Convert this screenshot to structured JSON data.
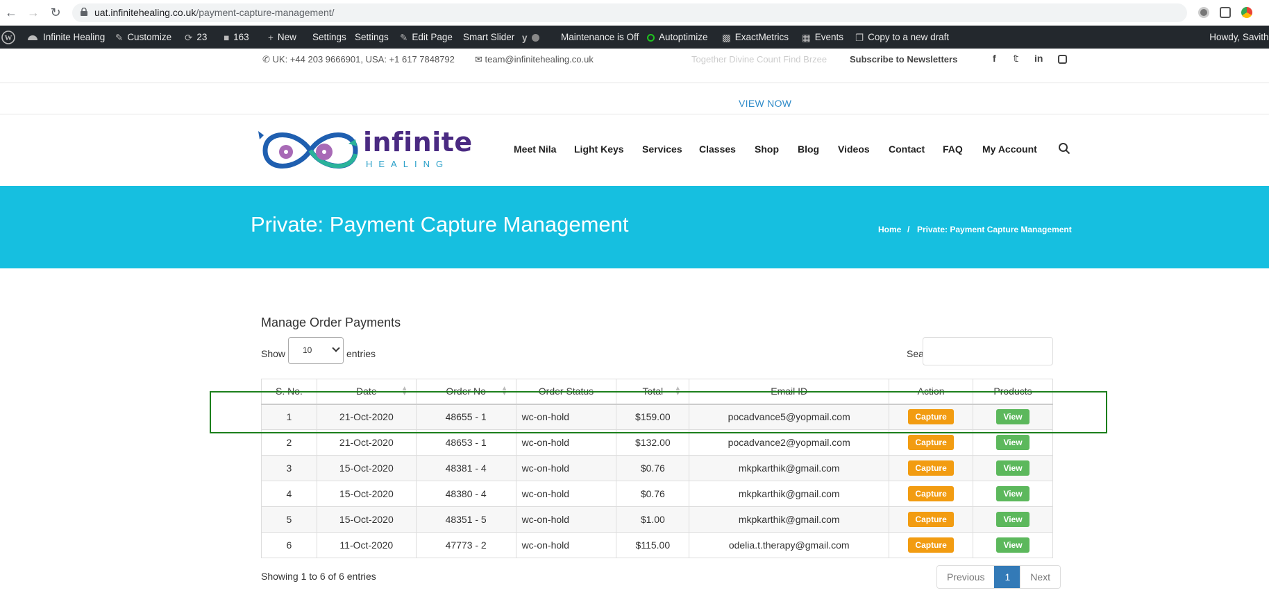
{
  "browser": {
    "url_host": "uat.infinitehealing.co.uk",
    "url_path": "/payment-capture-management/"
  },
  "admin_bar": {
    "site_name": "Infinite Healing",
    "customize": "Customize",
    "updates": "23",
    "comments": "163",
    "new": "New",
    "settings1": "Settings",
    "settings2": "Settings",
    "edit_page": "Edit Page",
    "smart_slider": "Smart Slider",
    "maintenance": "Maintenance is Off",
    "autoptimize": "Autoptimize",
    "exactmetrics": "ExactMetrics",
    "events": "Events",
    "copy_draft": "Copy to a new draft",
    "howdy": "Howdy, Savithr"
  },
  "contact": {
    "phone": "UK: +44 203 9666901, USA: +1 617 7848792",
    "email": "team@infinitehealing.co.uk",
    "tagline": "Together Divine Count Find Brzee",
    "subscribe": "Subscribe to Newsletters",
    "view_now": "VIEW NOW"
  },
  "logo": {
    "text_main": "infinite",
    "text_sub": "HEALING"
  },
  "menu": [
    "Meet Nila",
    "Light Keys",
    "Services",
    "Classes",
    "Shop",
    "Blog",
    "Videos",
    "Contact",
    "FAQ",
    "My Account"
  ],
  "banner": {
    "title": "Private: Payment Capture Management",
    "crumb_home": "Home",
    "crumb_sep": "/",
    "crumb_current": "Private: Payment Capture Management"
  },
  "content": {
    "section_title": "Manage Order Payments",
    "show_label": "Show",
    "show_value": "10",
    "entries_label": "entries",
    "search_label": "Search:",
    "info": "Showing 1 to 6 of 6 entries",
    "pager": {
      "prev": "Previous",
      "page": "1",
      "next": "Next"
    }
  },
  "table": {
    "headers": [
      "S. No.",
      "Date",
      "Order No",
      "Order Status",
      "Total",
      "Email ID",
      "Action",
      "Products"
    ],
    "capture_label": "Capture",
    "view_label": "View",
    "rows": [
      [
        "1",
        "21-Oct-2020",
        "48655 - 1",
        "wc-on-hold",
        "$159.00",
        "pocadvance5@yopmail.com"
      ],
      [
        "2",
        "21-Oct-2020",
        "48653 - 1",
        "wc-on-hold",
        "$132.00",
        "pocadvance2@yopmail.com"
      ],
      [
        "3",
        "15-Oct-2020",
        "48381 - 4",
        "wc-on-hold",
        "$0.76",
        "mkpkarthik@gmail.com"
      ],
      [
        "4",
        "15-Oct-2020",
        "48380 - 4",
        "wc-on-hold",
        "$0.76",
        "mkpkarthik@gmail.com"
      ],
      [
        "5",
        "15-Oct-2020",
        "48351 - 5",
        "wc-on-hold",
        "$1.00",
        "mkpkarthik@gmail.com"
      ],
      [
        "6",
        "11-Oct-2020",
        "47773 - 2",
        "wc-on-hold",
        "$115.00",
        "odelia.t.therapy@gmail.com"
      ]
    ]
  },
  "colors": {
    "banner": "#16bfe0",
    "capture": "#f29c11",
    "view": "#5cb85c",
    "highlight": "#1b7f1b"
  }
}
